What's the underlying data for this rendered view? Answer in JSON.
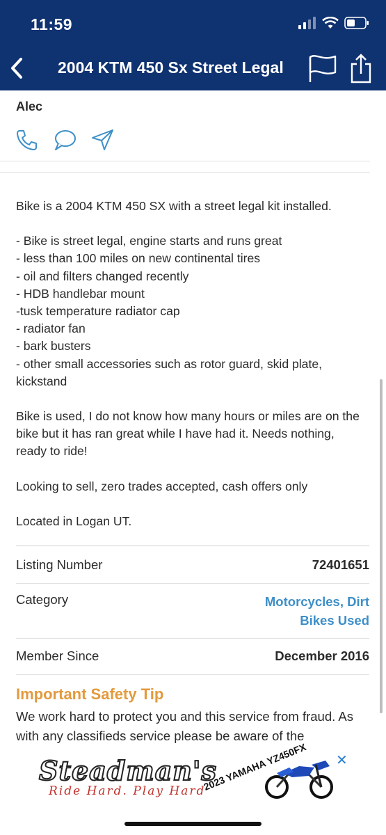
{
  "status": {
    "time": "11:59"
  },
  "nav": {
    "title": "2004 KTM 450 Sx Street Legal"
  },
  "seller": {
    "name": "Alec"
  },
  "description": {
    "intro": "Bike is a 2004 KTM 450 SX with a street legal kit installed.",
    "bullets": [
      "- Bike is street legal, engine starts and runs great",
      "- less than 100 miles on new continental tires",
      "- oil and filters changed recently",
      "- HDB handlebar mount",
      "-tusk temperature radiator cap",
      "- radiator fan",
      "- bark busters",
      "- other small accessories such as rotor guard, skid plate, kickstand"
    ],
    "condition": "Bike is used, I do not know how many hours or miles are on the bike but it has ran great while I have had it. Needs nothing, ready to ride!",
    "terms": "Looking to sell, zero trades accepted, cash offers only",
    "location": "Located in Logan UT."
  },
  "details": {
    "listing_number_label": "Listing Number",
    "listing_number": "72401651",
    "category_label": "Category",
    "category": "Motorcycles, Dirt Bikes Used",
    "member_since_label": "Member Since",
    "member_since": "December 2016"
  },
  "safety": {
    "title": "Important Safety Tip",
    "body": "We work hard to protect you and this service from fraud. As with any classifieds service please be aware of the"
  },
  "ad": {
    "logo": "Steadman's",
    "tagline": "Ride Hard. Play Hard",
    "model": "2023 YAMAHA YZ450FX",
    "close": "✕"
  },
  "colors": {
    "header": "#0f3270",
    "link": "#3d8fc7",
    "tip": "#e39a3d"
  }
}
